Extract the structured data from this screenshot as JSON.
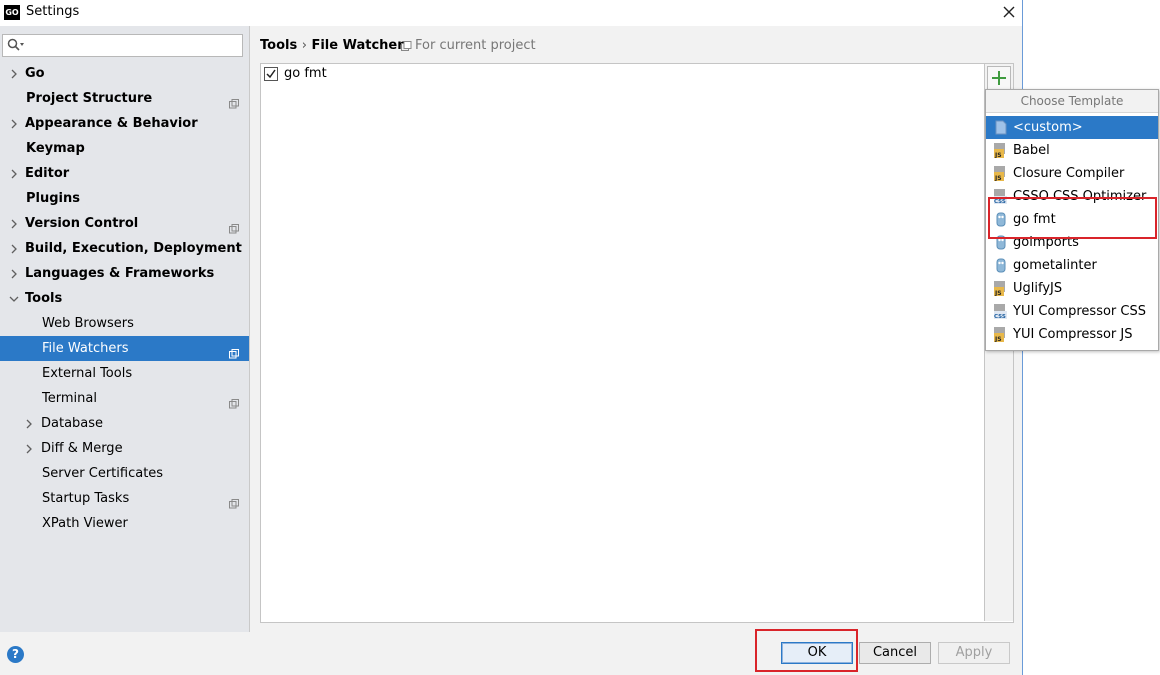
{
  "window": {
    "title": "Settings",
    "app_icon_text": "GO"
  },
  "sidebar": {
    "search": {
      "value": "",
      "placeholder": ""
    },
    "items": [
      {
        "label": "Go",
        "bold": true,
        "arrow": true,
        "project": false
      },
      {
        "label": "Project Structure",
        "bold": true,
        "arrow": false,
        "project": true
      },
      {
        "label": "Appearance & Behavior",
        "bold": true,
        "arrow": true,
        "project": false
      },
      {
        "label": "Keymap",
        "bold": true,
        "arrow": false,
        "project": false
      },
      {
        "label": "Editor",
        "bold": true,
        "arrow": true,
        "project": false
      },
      {
        "label": "Plugins",
        "bold": true,
        "arrow": false,
        "project": false
      },
      {
        "label": "Version Control",
        "bold": true,
        "arrow": true,
        "project": true
      },
      {
        "label": "Build, Execution, Deployment",
        "bold": true,
        "arrow": true,
        "project": false
      },
      {
        "label": "Languages & Frameworks",
        "bold": true,
        "arrow": true,
        "project": false
      },
      {
        "label": "Tools",
        "bold": true,
        "arrow": true,
        "expanded": true,
        "project": false
      },
      {
        "label": "Web Browsers",
        "bold": false,
        "arrow": false,
        "project": false
      },
      {
        "label": "File Watchers",
        "bold": false,
        "arrow": false,
        "project": true,
        "selected": true
      },
      {
        "label": "External Tools",
        "bold": false,
        "arrow": false,
        "project": false
      },
      {
        "label": "Terminal",
        "bold": false,
        "arrow": false,
        "project": true
      },
      {
        "label": "Database",
        "bold": false,
        "arrow": true,
        "project": false
      },
      {
        "label": "Diff & Merge",
        "bold": false,
        "arrow": true,
        "project": false
      },
      {
        "label": "Server Certificates",
        "bold": false,
        "arrow": false,
        "project": false
      },
      {
        "label": "Startup Tasks",
        "bold": false,
        "arrow": false,
        "project": true
      },
      {
        "label": "XPath Viewer",
        "bold": false,
        "arrow": false,
        "project": false
      }
    ]
  },
  "header": {
    "breadcrumb_parent": "Tools",
    "breadcrumb_separator": "›",
    "breadcrumb_current": "File Watchers",
    "scope_label": "For current project"
  },
  "watchers": [
    {
      "name": "go fmt",
      "enabled": true
    }
  ],
  "toolbar": {
    "add_label": "+"
  },
  "template_popup": {
    "title": "Choose Template",
    "items": [
      {
        "label": "<custom>",
        "icon": "custom-icon",
        "selected": true
      },
      {
        "label": "Babel",
        "icon": "js-icon"
      },
      {
        "label": "Closure Compiler",
        "icon": "js-icon"
      },
      {
        "label": "CSSO CSS Optimizer",
        "icon": "css-icon"
      },
      {
        "label": "go fmt",
        "icon": "go-icon"
      },
      {
        "label": "goimports",
        "icon": "go-icon"
      },
      {
        "label": "gometalinter",
        "icon": "go-icon"
      },
      {
        "label": "UglifyJS",
        "icon": "js-icon"
      },
      {
        "label": "YUI Compressor CSS",
        "icon": "css-icon"
      },
      {
        "label": "YUI Compressor JS",
        "icon": "js-icon"
      }
    ]
  },
  "footer": {
    "help": "?",
    "ok_label": "OK",
    "cancel_label": "Cancel",
    "apply_label": "Apply"
  },
  "colors": {
    "selection": "#2b79c7",
    "highlight": "#d9242a",
    "sidebar_bg": "#e4e6ea",
    "add_green": "#3f9b3f"
  }
}
